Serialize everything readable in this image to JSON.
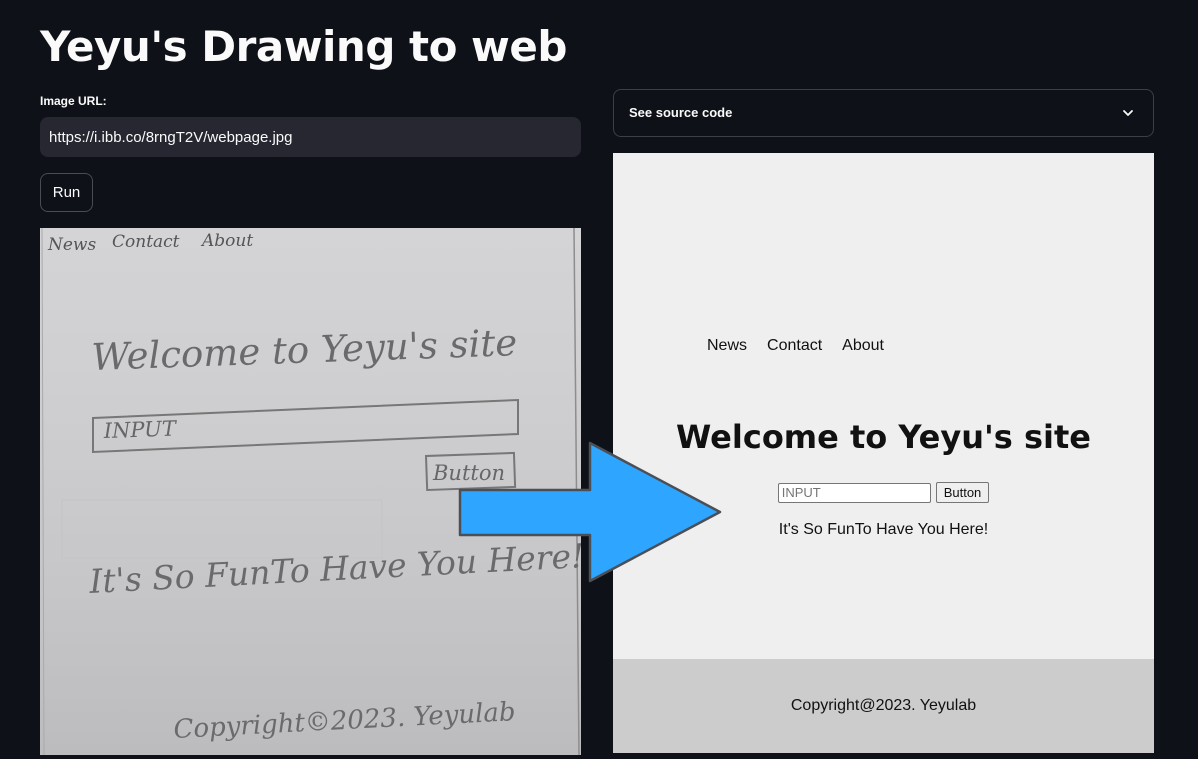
{
  "app": {
    "title": "Yeyu's Drawing to web"
  },
  "form": {
    "url_label": "Image URL:",
    "url_value": "https://i.ibb.co/8rngT2V/webpage.jpg",
    "run_label": "Run"
  },
  "sketch": {
    "nav": [
      "News",
      "Contact",
      "About"
    ],
    "heading": "Welcome to Yeyu's site",
    "input_text": "INPUT",
    "button_text": "Button",
    "tagline": "It's So FunTo Have You Here!",
    "footer": "Copyright©2023. Yeyulab"
  },
  "expander": {
    "label": "See source code"
  },
  "preview": {
    "nav": [
      "News",
      "Contact",
      "About"
    ],
    "heading": "Welcome to Yeyu's site",
    "input_placeholder": "INPUT",
    "button_label": "Button",
    "tagline": "It's So FunTo Have You Here!",
    "footer": "Copyright@2023. Yeyulab"
  },
  "colors": {
    "arrow": "#2ea6ff",
    "background": "#0e1117",
    "input_bg": "#262730"
  }
}
